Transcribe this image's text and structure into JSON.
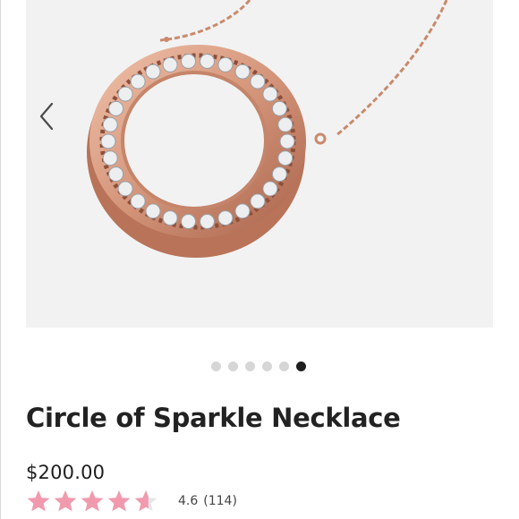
{
  "product": {
    "title": "Circle of Sparkle Necklace",
    "price": "$200.00",
    "rating_value": "4.6",
    "rating_count": "(114)",
    "rating_fraction": 0.92,
    "star_color": "#f19aae"
  },
  "gallery": {
    "image_count": 6,
    "active_index": 5,
    "prev_icon": "chevron-left-icon"
  },
  "colors": {
    "gallery_background": "#f2f2f2",
    "dot_inactive": "#d6d6d6",
    "dot_active": "#1f1f1f",
    "rose_gold": "#d4957a"
  }
}
